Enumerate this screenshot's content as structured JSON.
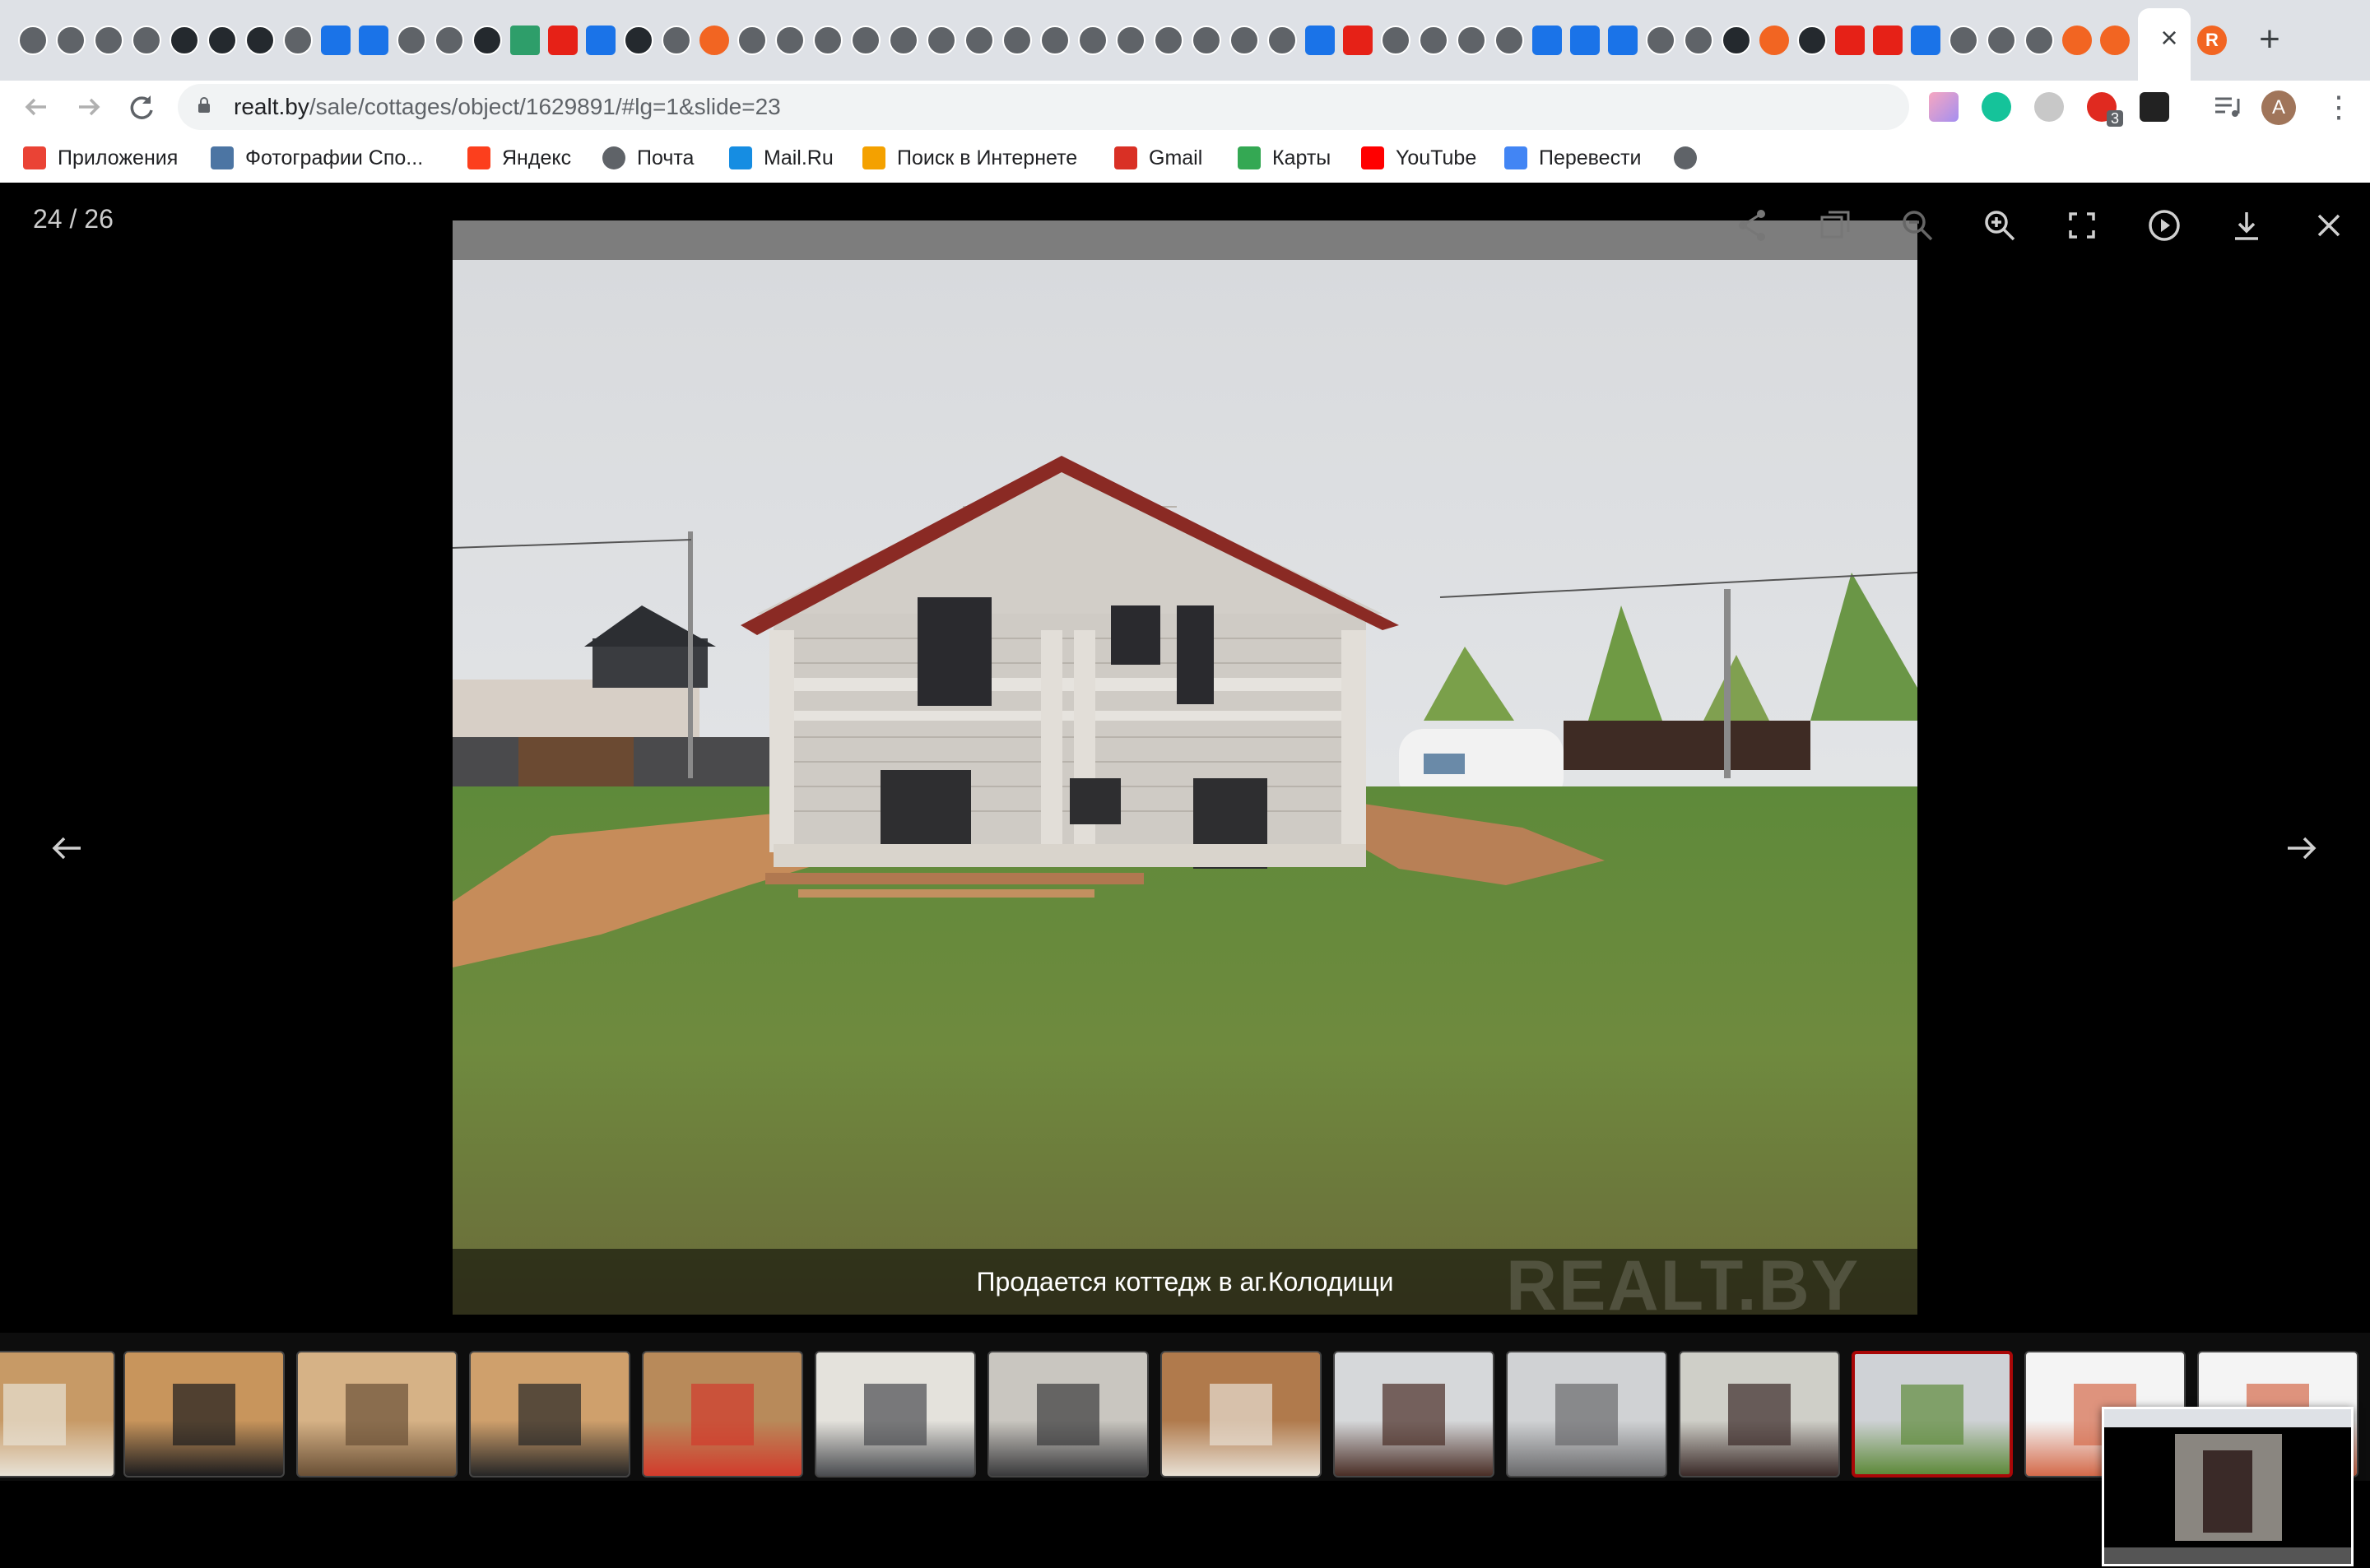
{
  "browser": {
    "tab_close": "×",
    "new_tab": "+",
    "tab_letter": "R",
    "url_host": "realt.by",
    "url_path": "/sale/cottages/object/1629891/#lg=1&slide=23",
    "extension_badge": "3",
    "avatar_letter": "A"
  },
  "bookmarks": [
    {
      "label": "Приложения",
      "icon": "apps-grid-icon",
      "color": "#ea4335"
    },
    {
      "label": "Фотографии Спо...",
      "icon": "vk-icon",
      "color": "#4c75a3"
    },
    {
      "label": "Яндекс",
      "icon": "yandex-icon",
      "color": "#fc3f1d"
    },
    {
      "label": "Почта",
      "icon": "globe-icon",
      "color": "#5f6368"
    },
    {
      "label": "Mail.Ru",
      "icon": "mailru-icon",
      "color": "#168de2"
    },
    {
      "label": "Поиск в Интернете",
      "icon": "search-icon",
      "color": "#f4a100"
    },
    {
      "label": "Gmail",
      "icon": "gmail-icon",
      "color": "#d93025"
    },
    {
      "label": "Карты",
      "icon": "maps-icon",
      "color": "#34a853"
    },
    {
      "label": "YouTube",
      "icon": "youtube-icon",
      "color": "#ff0000"
    },
    {
      "label": "Перевести",
      "icon": "translate-icon",
      "color": "#4285f4"
    },
    {
      "label": "",
      "icon": "globe-icon",
      "color": "#5f6368"
    }
  ],
  "gallery": {
    "counter": "24 / 26",
    "caption": "Продается коттедж в аг.Колодищи",
    "watermark": "REALT.BY",
    "toolbar_icons": [
      "share-icon",
      "copy-icon",
      "zoom-out-icon",
      "zoom-in-icon",
      "fullscreen-icon",
      "play-icon",
      "download-icon",
      "close-icon"
    ],
    "thumbnails": [
      {
        "subject": "wood-interior",
        "active": false
      },
      {
        "subject": "wood-interior-window",
        "active": false
      },
      {
        "subject": "attic-ceiling",
        "active": false
      },
      {
        "subject": "wood-room-door",
        "active": false
      },
      {
        "subject": "boiler-room",
        "active": false
      },
      {
        "subject": "white-window",
        "active": false
      },
      {
        "subject": "balcony-door",
        "active": false
      },
      {
        "subject": "bathroom",
        "active": false
      },
      {
        "subject": "brown-fence",
        "active": false
      },
      {
        "subject": "gate",
        "active": false
      },
      {
        "subject": "gate-door",
        "active": false
      },
      {
        "subject": "house-exterior",
        "active": true
      },
      {
        "subject": "floor-plan",
        "active": false
      },
      {
        "subject": "floor-plan",
        "active": false
      }
    ]
  },
  "colors": {
    "accent": "#a90707",
    "overlay": "#000000"
  }
}
